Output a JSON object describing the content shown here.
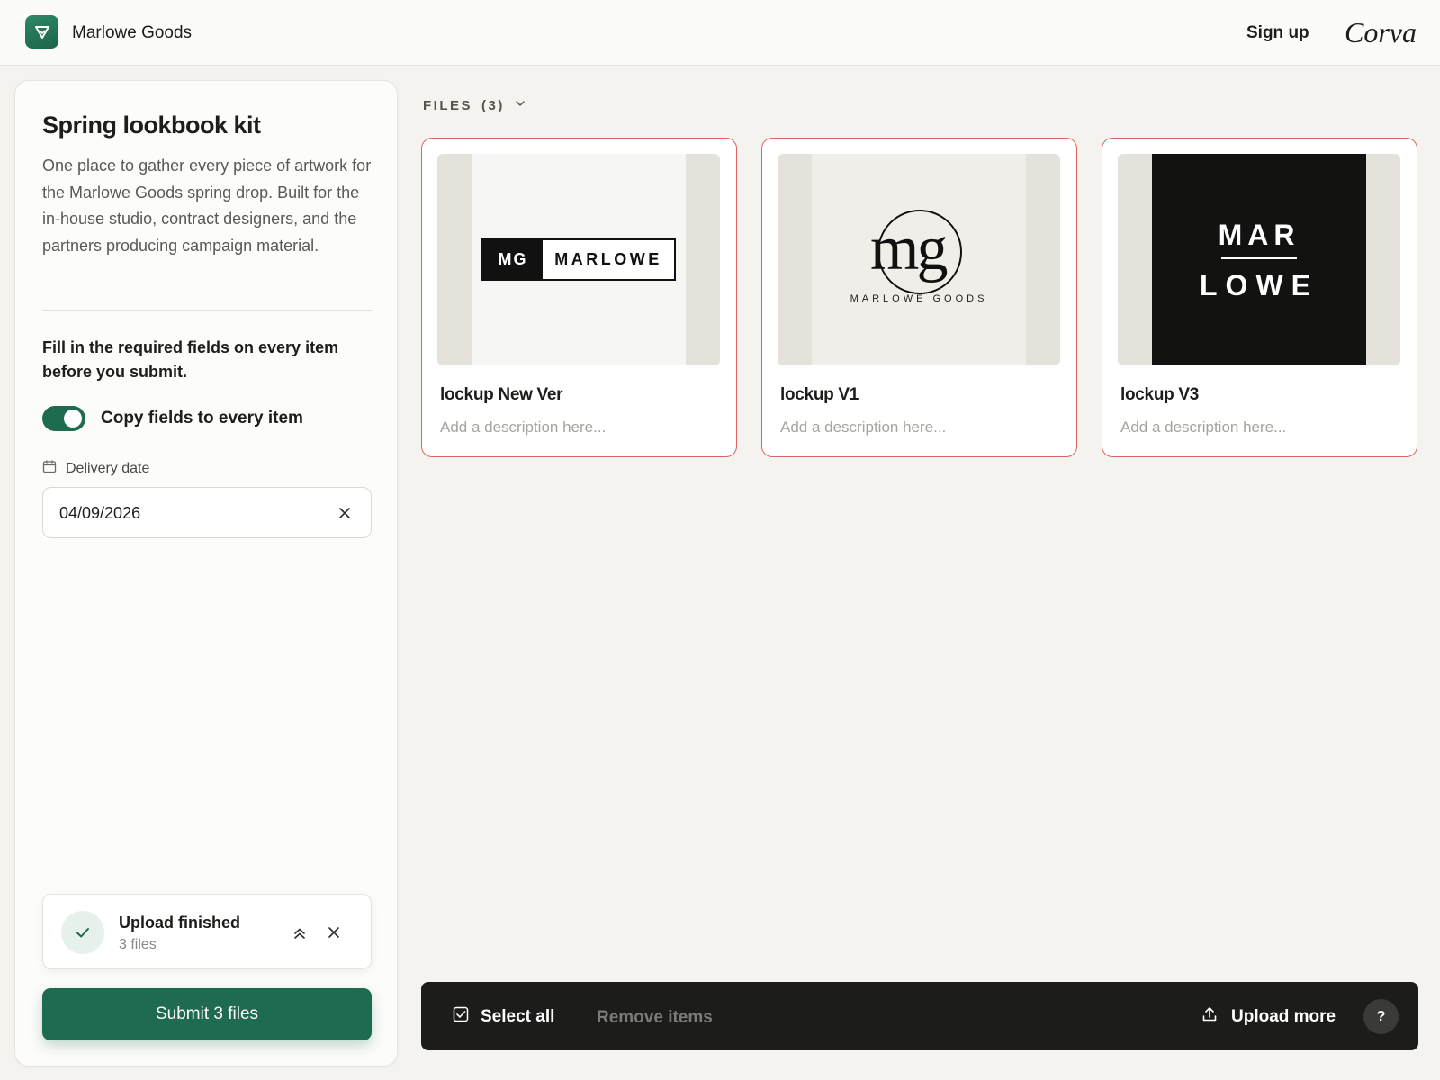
{
  "header": {
    "brand_name": "Marlowe Goods",
    "signup_label": "Sign up",
    "partner_logo": "Corva"
  },
  "panel": {
    "title": "Spring lookbook kit",
    "description": "One place to gather every piece of artwork for the Marlowe Goods spring drop. Built for the in-house studio, contract designers, and the partners producing campaign material.",
    "note": "Fill in the required fields on every item before you submit.",
    "copy_toggle": {
      "label": "Copy fields to every item",
      "on": true
    },
    "delivery": {
      "label": "Delivery date",
      "value": "04/09/2026"
    },
    "upload_toast": {
      "title": "Upload finished",
      "subtitle": "3 files"
    },
    "submit_label": "Submit 3 files"
  },
  "files": {
    "header_label": "FILES",
    "count_label": "(3)",
    "items": [
      {
        "name": "lockup New Ver",
        "description_placeholder": "Add a description here...",
        "art": {
          "mark": "MG",
          "word": "MARLOWE"
        }
      },
      {
        "name": "lockup V1",
        "description_placeholder": "Add a description here...",
        "art": {
          "mark": "mg",
          "word": "MARLOWE GOODS"
        }
      },
      {
        "name": "lockup V3",
        "description_placeholder": "Add a description here...",
        "art": {
          "line1": "MAR",
          "line2": "LOWE"
        }
      }
    ]
  },
  "action_bar": {
    "select_all_label": "Select all",
    "remove_label": "Remove items",
    "upload_more_label": "Upload more",
    "help_label": "?"
  },
  "colors": {
    "brand_green": "#1f6b52",
    "card_error_border": "#d9665f",
    "action_bar": "#1c1c1a"
  },
  "icons": [
    "brand-logo-icon",
    "calendar-icon",
    "close-icon",
    "check-icon",
    "chevron-double-up-icon",
    "chevron-down-icon",
    "checkbox-icon",
    "upload-icon",
    "help-icon"
  ]
}
